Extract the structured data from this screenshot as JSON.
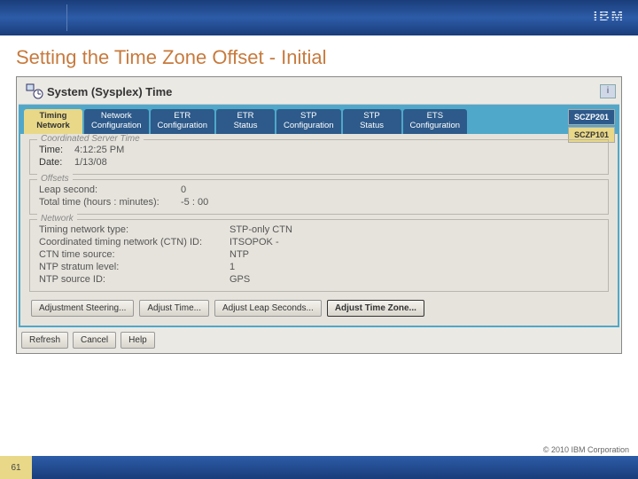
{
  "header": {
    "logo": "IBM"
  },
  "slide": {
    "title": "Setting the Time Zone Offset - Initial",
    "page_number": "61",
    "copyright": "© 2010 IBM Corporation"
  },
  "panel": {
    "title": "System (Sysplex) Time",
    "info_char": "i"
  },
  "tabs": [
    {
      "line1": "Timing",
      "line2": "Network"
    },
    {
      "line1": "Network",
      "line2": "Configuration"
    },
    {
      "line1": "ETR",
      "line2": "Configuration"
    },
    {
      "line1": "ETR",
      "line2": "Status"
    },
    {
      "line1": "STP",
      "line2": "Configuration"
    },
    {
      "line1": "STP",
      "line2": "Status"
    },
    {
      "line1": "ETS",
      "line2": "Configuration"
    }
  ],
  "side_labels": [
    "SCZP201",
    "SCZP101"
  ],
  "sections": {
    "server_time": {
      "legend": "Coordinated Server Time",
      "time_label": "Time:",
      "time_value": "4:12:25 PM",
      "date_label": "Date:",
      "date_value": "1/13/08"
    },
    "offsets": {
      "legend": "Offsets",
      "leap_label": "Leap second:",
      "leap_value": "0",
      "total_label": "Total time (hours : minutes):",
      "total_value": "-5 : 00"
    },
    "network": {
      "legend": "Network",
      "type_label": "Timing network type:",
      "type_value": "STP-only CTN",
      "ctn_label": "Coordinated timing network (CTN) ID:",
      "ctn_value": "ITSOPOK -",
      "source_label": "CTN time source:",
      "source_value": "NTP",
      "stratum_label": "NTP stratum level:",
      "stratum_value": "1",
      "ntpid_label": "NTP source ID:",
      "ntpid_value": "GPS"
    }
  },
  "buttons": {
    "adj_steering": "Adjustment Steering...",
    "adj_time": "Adjust Time...",
    "adj_leap": "Adjust Leap Seconds...",
    "adj_tz": "Adjust Time Zone...",
    "refresh": "Refresh",
    "cancel": "Cancel",
    "help": "Help"
  }
}
